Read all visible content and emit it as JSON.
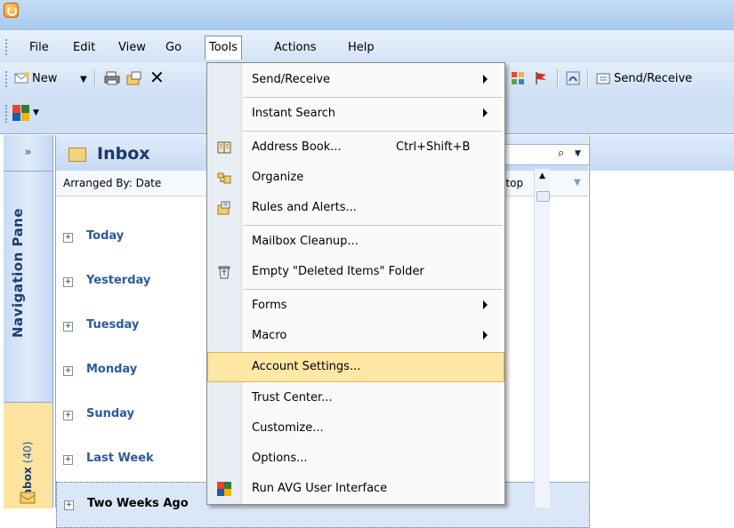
{
  "menubar": {
    "items": [
      "File",
      "Edit",
      "View",
      "Go",
      "Tools",
      "Actions",
      "Help"
    ],
    "active": "Tools"
  },
  "toolbar": {
    "new_label": "New",
    "send_receive_label": "Send/Receive"
  },
  "navpane": {
    "title": "Navigation Pane",
    "inbox_tab_label": "Inbox",
    "inbox_count": "(40)"
  },
  "maillist": {
    "folder_title": "Inbox",
    "arranged_by": "Arranged By: Date",
    "sort_label": "n top",
    "groups": [
      "Today",
      "Yesterday",
      "Tuesday",
      "Monday",
      "Sunday",
      "Last Week",
      "Two Weeks Ago"
    ]
  },
  "tools_menu": {
    "items": [
      {
        "label": "Send/Receive",
        "submenu": true
      },
      {
        "label": "Instant Search",
        "submenu": true
      },
      {
        "label": "Address Book...",
        "shortcut": "Ctrl+Shift+B",
        "icon": "address-book-icon"
      },
      {
        "label": "Organize",
        "icon": "organize-icon"
      },
      {
        "label": "Rules and Alerts...",
        "icon": "rules-alerts-icon"
      },
      {
        "label": "Mailbox Cleanup..."
      },
      {
        "label": "Empty \"Deleted Items\" Folder",
        "icon": "empty-trash-icon"
      },
      {
        "label": "Forms",
        "submenu": true
      },
      {
        "label": "Macro",
        "submenu": true
      },
      {
        "label": "Account Settings...",
        "highlighted": true
      },
      {
        "label": "Trust Center..."
      },
      {
        "label": "Customize..."
      },
      {
        "label": "Options..."
      },
      {
        "label": "Run AVG User Interface",
        "icon": "avg-icon"
      }
    ]
  },
  "colors": {
    "accent": "#2c5aa0",
    "menu_highlight": "#ffe7a6",
    "titlebar": "#a9c9ee"
  }
}
